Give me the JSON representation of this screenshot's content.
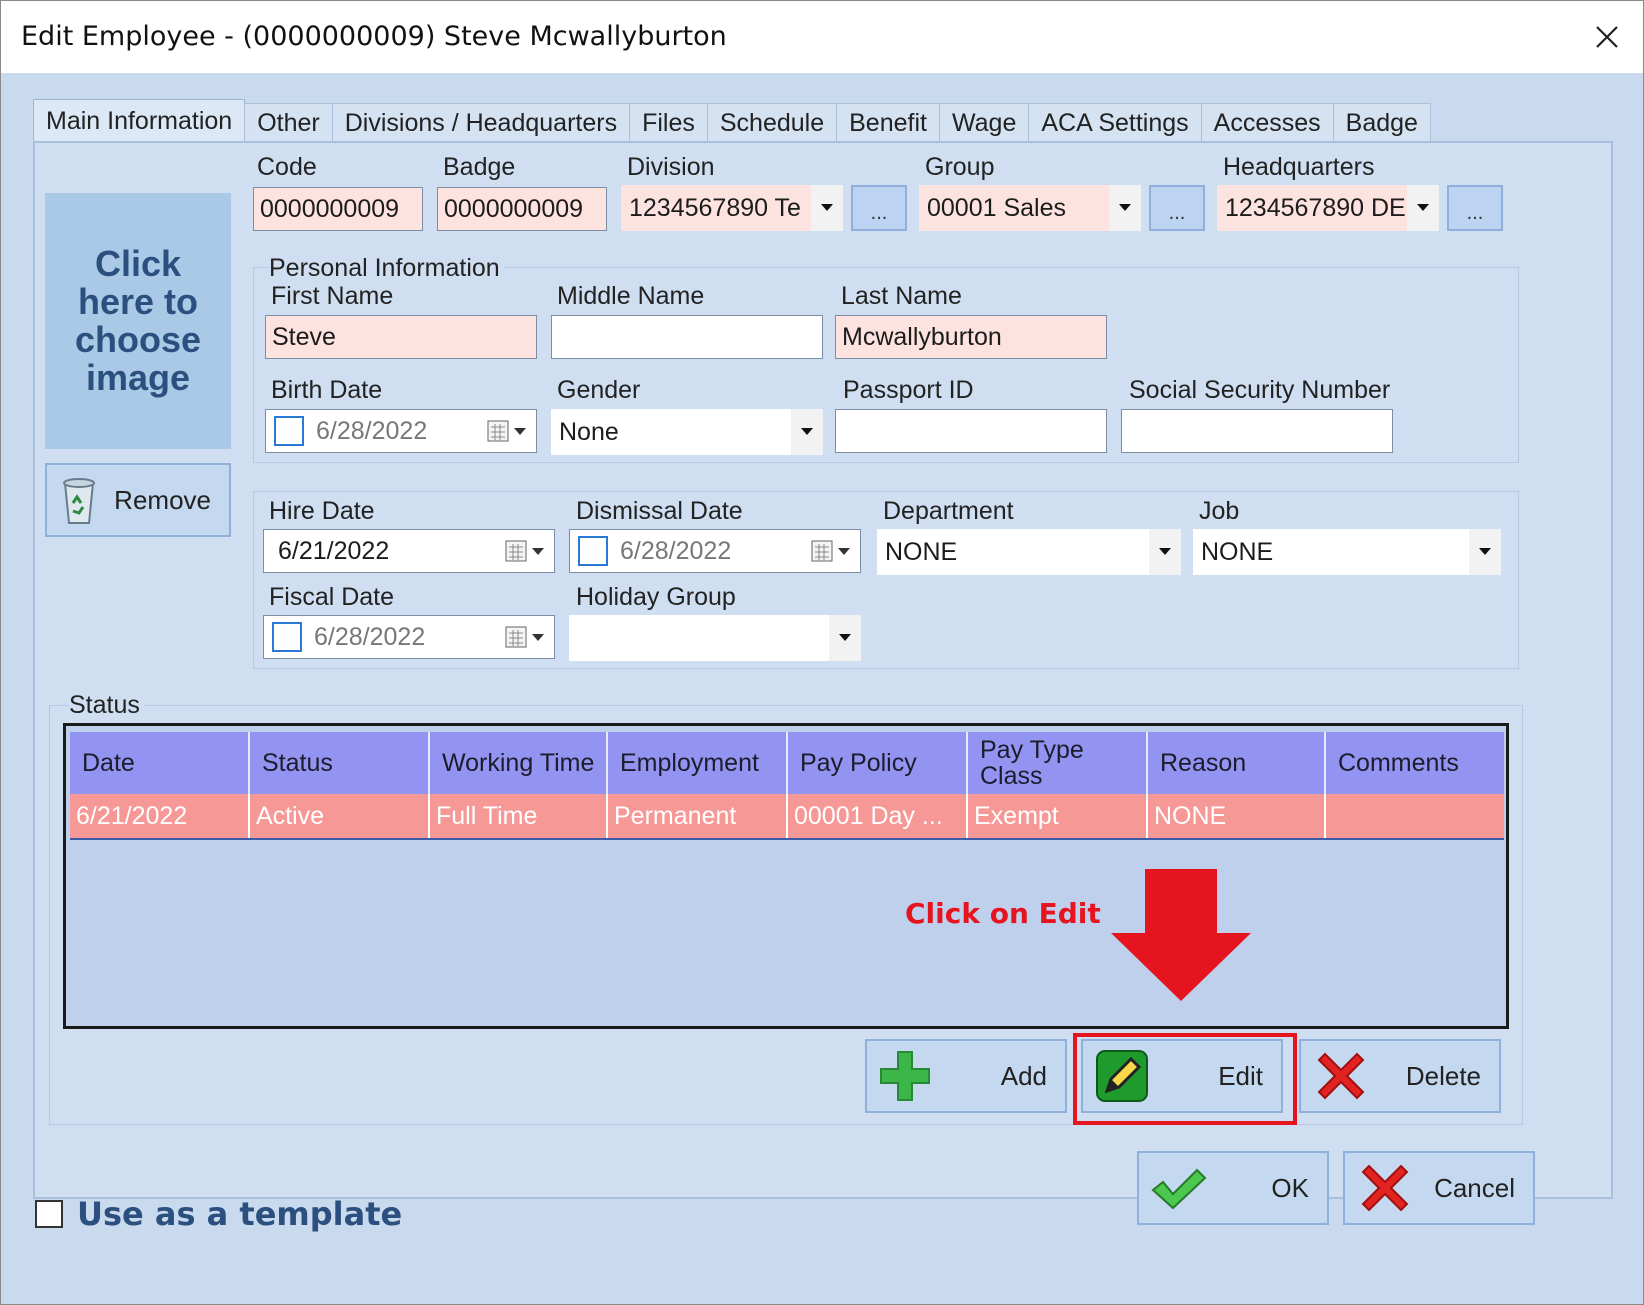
{
  "window": {
    "title": "Edit Employee - (0000000009) Steve Mcwallyburton"
  },
  "tabs": [
    {
      "label": "Main Information"
    },
    {
      "label": "Other"
    },
    {
      "label": "Divisions / Headquarters"
    },
    {
      "label": "Files"
    },
    {
      "label": "Schedule"
    },
    {
      "label": "Benefit"
    },
    {
      "label": "Wage"
    },
    {
      "label": "ACA Settings"
    },
    {
      "label": "Accesses"
    },
    {
      "label": "Badge"
    }
  ],
  "photo": {
    "prompt": "Click here to choose image",
    "remove_label": "Remove"
  },
  "top_fields": {
    "code": {
      "label": "Code",
      "value": "0000000009"
    },
    "badge": {
      "label": "Badge",
      "value": "0000000009"
    },
    "division": {
      "label": "Division",
      "value": "1234567890   Te"
    },
    "group": {
      "label": "Group",
      "value": "00001   Sales"
    },
    "headquarters": {
      "label": "Headquarters",
      "value": "1234567890   DE"
    },
    "ellipsis": "..."
  },
  "personal": {
    "legend": "Personal Information",
    "first_name": {
      "label": "First Name",
      "value": "Steve"
    },
    "middle_name": {
      "label": "Middle Name",
      "value": ""
    },
    "last_name": {
      "label": "Last Name",
      "value": "Mcwallyburton"
    },
    "birth_date": {
      "label": "Birth Date",
      "value": "6/28/2022"
    },
    "gender": {
      "label": "Gender",
      "value": "None"
    },
    "passport": {
      "label": "Passport ID",
      "value": ""
    },
    "ssn": {
      "label": "Social Security Number",
      "value": ""
    }
  },
  "employment": {
    "hire_date": {
      "label": "Hire Date",
      "value": "6/21/2022"
    },
    "dismissal_date": {
      "label": "Dismissal Date",
      "value": "6/28/2022"
    },
    "department": {
      "label": "Department",
      "value": "NONE"
    },
    "job": {
      "label": "Job",
      "value": "NONE"
    },
    "fiscal_date": {
      "label": "Fiscal Date",
      "value": "6/28/2022"
    },
    "holiday_group": {
      "label": "Holiday Group",
      "value": ""
    }
  },
  "status": {
    "legend": "Status",
    "columns": [
      "Date",
      "Status",
      "Working Time",
      "Employment",
      "Pay Policy",
      "Pay Type Class",
      "Reason",
      "Comments"
    ],
    "rows": [
      [
        "6/21/2022",
        "Active",
        "Full Time",
        "Permanent",
        "00001   Day ...",
        "Exempt",
        "NONE",
        ""
      ]
    ],
    "add_label": "Add",
    "edit_label": "Edit",
    "delete_label": "Delete"
  },
  "annotation": {
    "text": "Click on Edit",
    "color": "#e5141e"
  },
  "footer": {
    "template_label": "Use as a template",
    "ok_label": "OK",
    "cancel_label": "Cancel"
  },
  "colors": {
    "required_field": "#fde3e0",
    "grid_header": "#9393f2",
    "grid_row_selected": "#f69896",
    "panel": "#cfdff1"
  }
}
